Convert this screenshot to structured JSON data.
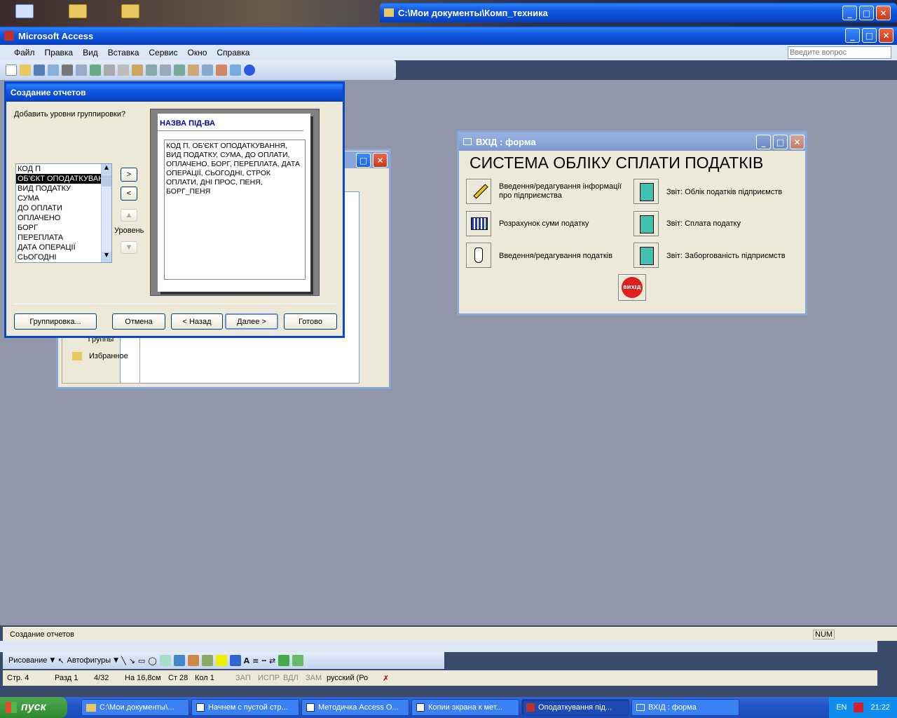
{
  "explorer_window": {
    "title": "C:\\Мои документы\\Комп_техника"
  },
  "access": {
    "title": "Microsoft Access",
    "menu": [
      "Файл",
      "Правка",
      "Вид",
      "Вставка",
      "Сервис",
      "Окно",
      "Справка"
    ],
    "help_placeholder": "Введите вопрос"
  },
  "db_window": {
    "groups_label": "Группы",
    "favorites_label": "Избранное"
  },
  "wizard": {
    "title": "Создание отчетов",
    "prompt": "Добавить уровни группировки?",
    "fields": [
      "КОД П",
      "ОБ'ЄКТ ОПОДАТКУВАННЯ",
      "ВИД ПОДАТКУ",
      "СУМА",
      "ДО ОПЛАТИ",
      "ОПЛАЧЕНО",
      "БОРГ",
      "ПЕРЕПЛАТА",
      "ДАТА ОПЕРАЦІЇ",
      "СЬОГОДНІ"
    ],
    "selected_field": "ОБ'ЄКТ ОПОДАТКУВАН",
    "add_btn": ">",
    "remove_btn": "<",
    "level_label": "Уровень",
    "preview_group": "НАЗВА ПІД-ВА",
    "preview_fields": "КОД П, ОБ'ЄКТ ОПОДАТКУВАННЯ, ВИД ПОДАТКУ, СУМА, ДО ОПЛАТИ, ОПЛАЧЕНО, БОРГ, ПЕРЕПЛАТА, ДАТА ОПЕРАЦІЇ, СЬОГОДНІ, СТРОК ОПЛАТИ, ДНІ ПРОС, ПЕНЯ, БОРГ_ПЕНЯ",
    "buttons": {
      "grouping": "Группировка...",
      "cancel": "Отмена",
      "back": "< Назад",
      "next": "Далее >",
      "finish": "Готово"
    }
  },
  "form": {
    "title": "ВХІД : форма",
    "heading": "СИСТЕМА ОБЛІКУ СПЛАТИ ПОДАТКІВ",
    "items": [
      {
        "label": "Введення/редагування інформації про підприємства",
        "icon": "pencil-icon"
      },
      {
        "label": "Розрахунок суми податку",
        "icon": "calculator-icon"
      },
      {
        "label": "Введення/редагування податків",
        "icon": "hand-pointer-icon"
      },
      {
        "label": "Звіт: Облік податків підприємств",
        "icon": "notebook-icon"
      },
      {
        "label": "Звіт: Сплата податку",
        "icon": "notebook-icon"
      },
      {
        "label": "Звіт: Заборгованість підприємств",
        "icon": "notebook-icon"
      }
    ],
    "exit_label": "ВИХІД"
  },
  "access_status": {
    "text": "Создание отчетов",
    "num": "NUM"
  },
  "word_drawing": {
    "draw_label": "Рисование",
    "autoshapes_label": "Автофигуры"
  },
  "word_status": {
    "page": "Стр. 4",
    "section": "Разд 1",
    "pages": "4/32",
    "at": "На 16,8см",
    "line": "Ст 28",
    "col": "Кол 1",
    "rec": "ЗАП",
    "trk": "ИСПР",
    "ext": "ВДЛ",
    "ovr": "ЗАМ",
    "lang": "русский (Ро"
  },
  "taskbar": {
    "start": "пуск",
    "items": [
      "C:\\Мои документы\\...",
      "Начнем с пустой стр...",
      "Методичка Access О...",
      "Копии экрана к мет...",
      "Оподаткування під...",
      "ВХІД : форма"
    ],
    "lang": "EN",
    "time": "21:22"
  },
  "colors": {
    "xp_blue": "#0a46d0",
    "mdi_bg": "#8f97a9",
    "selection": "#000000"
  }
}
